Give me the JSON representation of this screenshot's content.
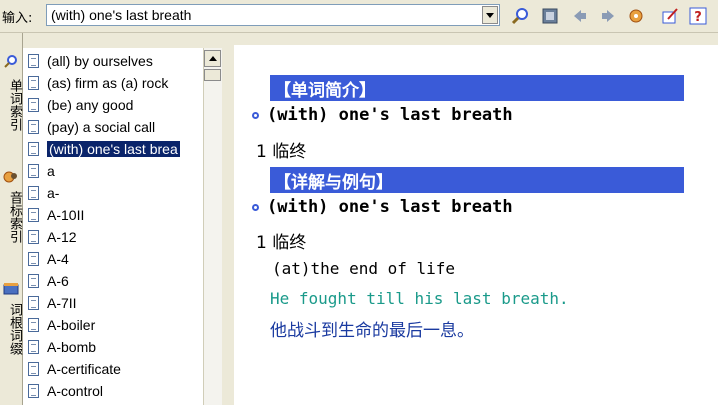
{
  "toolbar": {
    "input_label": "输入:",
    "search_value": "(with) one's last breath",
    "icons": [
      "search-icon",
      "book-icon",
      "back-arrow-icon",
      "forward-arrow-icon",
      "tools-icon",
      "edit-icon",
      "help-icon"
    ],
    "help_glyph": "?"
  },
  "left_tabs": [
    {
      "label": "单词索引",
      "icon": "search-icon"
    },
    {
      "label": "音标索引",
      "icon": "sound-icon"
    },
    {
      "label": "词根词缀",
      "icon": "books-icon"
    }
  ],
  "word_list": {
    "items": [
      "(all) by ourselves",
      "(as) firm as (a) rock",
      "(be) any good",
      "(pay) a social call",
      "(with) one's last brea",
      "a",
      "a-",
      "A-10II",
      "A-12",
      "A-4",
      "A-6",
      "A-7II",
      "A-boiler",
      "A-bomb",
      "A-certificate",
      "A-control"
    ],
    "selected_index": 4
  },
  "content": {
    "section1_title": "【单词简介】",
    "entry1": "(with) one's last breath",
    "sense1": "1 临终",
    "section2_title": "【详解与例句】",
    "entry2": "(with) one's last breath",
    "sense2": "1 临终",
    "definition": "(at)the end of life",
    "example_en": "He fought till his last breath.",
    "example_zh": "他战斗到生命的最后一息。"
  },
  "colors": {
    "section_header_bg": "#3a5bd8",
    "example_en": "#1a9a8a",
    "example_zh": "#1a3aa0",
    "selected_bg": "#0a246a"
  }
}
